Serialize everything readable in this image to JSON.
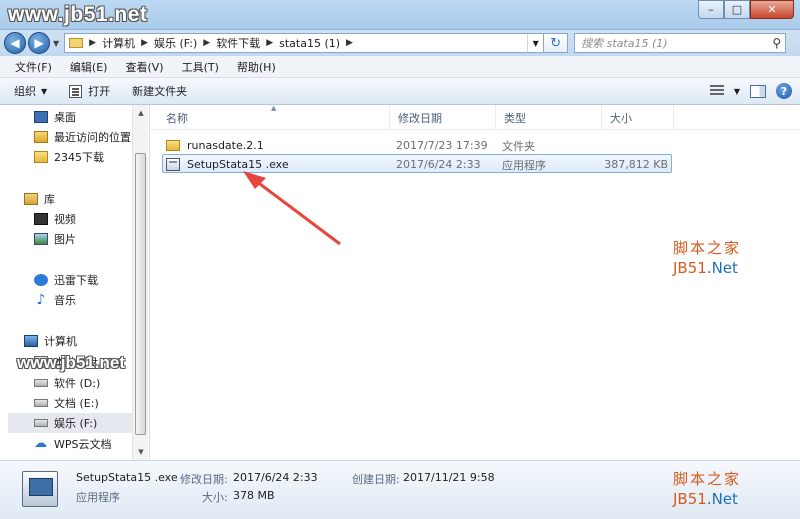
{
  "watermark": {
    "top": "www.jb51.net",
    "mid": "www.jb51.net",
    "right_cn": "脚本之家",
    "right_en_a": "JB51",
    "right_en_b": ".Net"
  },
  "window_buttons": {
    "minimize": "–",
    "maximize": "□",
    "close": "✕"
  },
  "address": {
    "crumbs": [
      "计算机",
      "娱乐 (F:)",
      "软件下载",
      "stata15 (1)"
    ],
    "search_placeholder": "搜索 stata15 (1)"
  },
  "menu": [
    "文件(F)",
    "编辑(E)",
    "查看(V)",
    "工具(T)",
    "帮助(H)"
  ],
  "toolbar": {
    "organize": "组织",
    "open": "打开",
    "new_folder": "新建文件夹"
  },
  "nav": {
    "desktop": "桌面",
    "recent": "最近访问的位置",
    "downloads2345": "2345下载",
    "library": "库",
    "video": "视频",
    "pictures": "图片",
    "thunder": "迅雷下载",
    "music": "音乐",
    "computer": "计算机",
    "drive_c": "本地磁盘 (C:)",
    "drive_d": "软件 (D:)",
    "drive_e": "文档 (E:)",
    "drive_f": "娱乐 (F:)",
    "wps": "WPS云文档"
  },
  "columns": {
    "name": "名称",
    "modified": "修改日期",
    "type": "类型",
    "size": "大小"
  },
  "files": [
    {
      "name": "runasdate.2.1",
      "modified": "2017/7/23 17:39",
      "type": "文件夹",
      "size": ""
    },
    {
      "name": "SetupStata15 .exe",
      "modified": "2017/6/24 2:33",
      "type": "应用程序",
      "size": "387,812 KB"
    }
  ],
  "details": {
    "filename": "SetupStata15 .exe",
    "filetype": "应用程序",
    "modified_label": "修改日期:",
    "modified_value": "2017/6/24 2:33",
    "created_label": "创建日期:",
    "created_value": "2017/11/21 9:58",
    "size_label": "大小:",
    "size_value": "378 MB"
  },
  "colors": {
    "arrow": "#e8463c",
    "selection_border": "#84acdd"
  }
}
